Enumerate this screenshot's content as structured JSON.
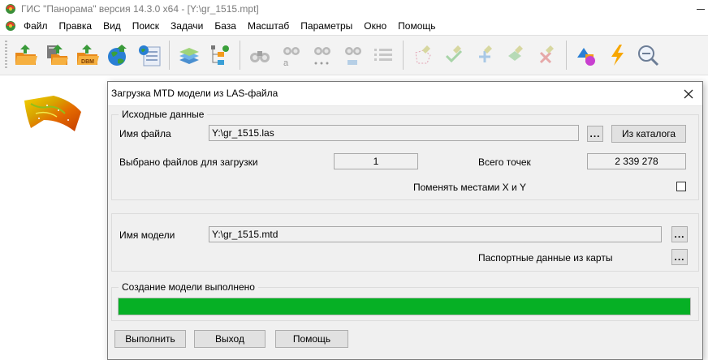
{
  "app": {
    "title": "ГИС \"Панорама\" версия 14.3.0 x64 - [Y:\\gr_1515.mpt]"
  },
  "menu": {
    "items": [
      "Файл",
      "Правка",
      "Вид",
      "Поиск",
      "Задачи",
      "База",
      "Масштаб",
      "Параметры",
      "Окно",
      "Помощь"
    ]
  },
  "toolbar": {
    "buttons": [
      {
        "icon": "open-folder-icon"
      },
      {
        "icon": "open-data-icon"
      },
      {
        "icon": "open-dbm-icon",
        "label": "DBM"
      },
      {
        "icon": "globe-icon"
      },
      {
        "icon": "map-document-icon"
      },
      {
        "icon": "layers-icon"
      },
      {
        "icon": "tree-list-icon"
      },
      {
        "icon": "binoculars-icon"
      },
      {
        "icon": "binoculars-text-icon"
      },
      {
        "icon": "binoculars-points-icon"
      },
      {
        "icon": "binoculars-selection-icon"
      },
      {
        "icon": "list-icon"
      },
      {
        "icon": "select-area-icon"
      },
      {
        "icon": "select-check-icon"
      },
      {
        "icon": "select-add-icon"
      },
      {
        "icon": "select-copy-icon"
      },
      {
        "icon": "select-delete-icon"
      },
      {
        "icon": "shapes-3d-icon"
      },
      {
        "icon": "lightning-icon"
      },
      {
        "icon": "zoom-icon"
      }
    ],
    "colors": {
      "disabled": "#c7c7c7",
      "orange": "#f39a1c",
      "blue": "#2a7fd4"
    }
  },
  "dialog": {
    "title": "Загрузка MTD модели из LAS-файла",
    "source_group": {
      "legend": "Исходные данные",
      "file_label": "Имя файла",
      "file_value": "Y:\\gr_1515.las",
      "browse_label": "...",
      "catalog_label": "Из каталога",
      "selected_label": "Выбрано файлов для загрузки",
      "selected_value": "1",
      "points_label": "Всего точек",
      "points_value": "2 339 278",
      "swap_label": "Поменять местами X и Y"
    },
    "model_group": {
      "model_label": "Имя модели",
      "model_value": "Y:\\gr_1515.mtd",
      "browse_label": "...",
      "passport_label": "Паспортные данные из карты",
      "passport_button": "..."
    },
    "status_group": {
      "legend": "Создание модели выполнено",
      "progress": 1.0,
      "progress_color": "#06b025"
    },
    "buttons": {
      "run": "Выполнить",
      "exit": "Выход",
      "help": "Помощь"
    }
  }
}
